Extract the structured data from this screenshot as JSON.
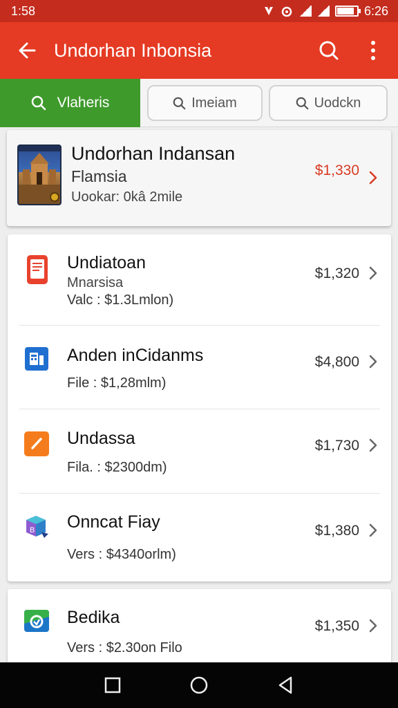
{
  "status_bar": {
    "left_time": "1:58",
    "right_time": "6:26"
  },
  "app_bar": {
    "title": "Undorhan Inbonsia",
    "icons": [
      "back-arrow-icon",
      "search-icon",
      "more-vert-icon"
    ]
  },
  "tabs": [
    {
      "label": "Vlaheris",
      "icon": "search-icon",
      "active": true
    },
    {
      "label": "Imeiam",
      "icon": "search-icon",
      "active": false
    },
    {
      "label": "Uodckn",
      "icon": "search-icon",
      "active": false
    }
  ],
  "featured": {
    "title": "Undorhan Indansan",
    "subtitle": "Flamsia",
    "meta": "Uookar: 0kâ 2mile",
    "price": "$1,330"
  },
  "items": [
    {
      "title": "Undiatoan",
      "subtitle": "Mnarsisa",
      "meta": "Valc : $1.3Lmlon)",
      "price": "$1,320",
      "icon": "document-icon"
    },
    {
      "title": "Anden inCidanms",
      "meta": "File : $1,28mlm)",
      "price": "$4,800",
      "icon": "calculator-icon"
    },
    {
      "title": "Undassa",
      "meta": "Fila. : $2300dm)",
      "price": "$1,730",
      "icon": "pen-icon"
    },
    {
      "title": "Onncat Fiay",
      "meta": "Vers : $4340orlm)",
      "price": "$1,380",
      "icon": "cube-icon"
    },
    {
      "title": "Bedika",
      "meta": "Vers : $2.30on Filo",
      "price": "$1,350",
      "icon": "phone-icon"
    }
  ],
  "colors": {
    "status_bar": "#c42c1e",
    "app_bar": "#e53a23",
    "active_tab": "#3f9a2c",
    "featured_price": "#d93b23"
  }
}
